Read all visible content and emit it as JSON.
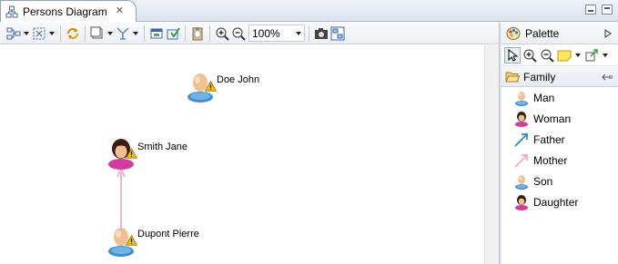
{
  "editor": {
    "tab_title": "Persons Diagram",
    "close_glyph": "✕"
  },
  "toolbar": {
    "zoom_value": "100%"
  },
  "diagram": {
    "nodes": [
      {
        "name": "Doe John",
        "kind": "man"
      },
      {
        "name": "Smith Jane",
        "kind": "woman"
      },
      {
        "name": "Dupont Pierre",
        "kind": "man"
      }
    ]
  },
  "palette": {
    "title": "Palette",
    "drawer": "Family",
    "items": [
      {
        "label": "Man",
        "icon": "man-icon"
      },
      {
        "label": "Woman",
        "icon": "woman-icon"
      },
      {
        "label": "Father",
        "icon": "father-link-icon"
      },
      {
        "label": "Mother",
        "icon": "mother-link-icon"
      },
      {
        "label": "Son",
        "icon": "son-icon"
      },
      {
        "label": "Daughter",
        "icon": "daughter-icon"
      }
    ]
  },
  "colors": {
    "man_body": "#3f8fd0",
    "woman_body": "#d63a9e",
    "skin": "#f2c08e",
    "father_link": "#1f8fd6",
    "mother_link": "#f0a6c8",
    "warning": "#f5c400"
  }
}
